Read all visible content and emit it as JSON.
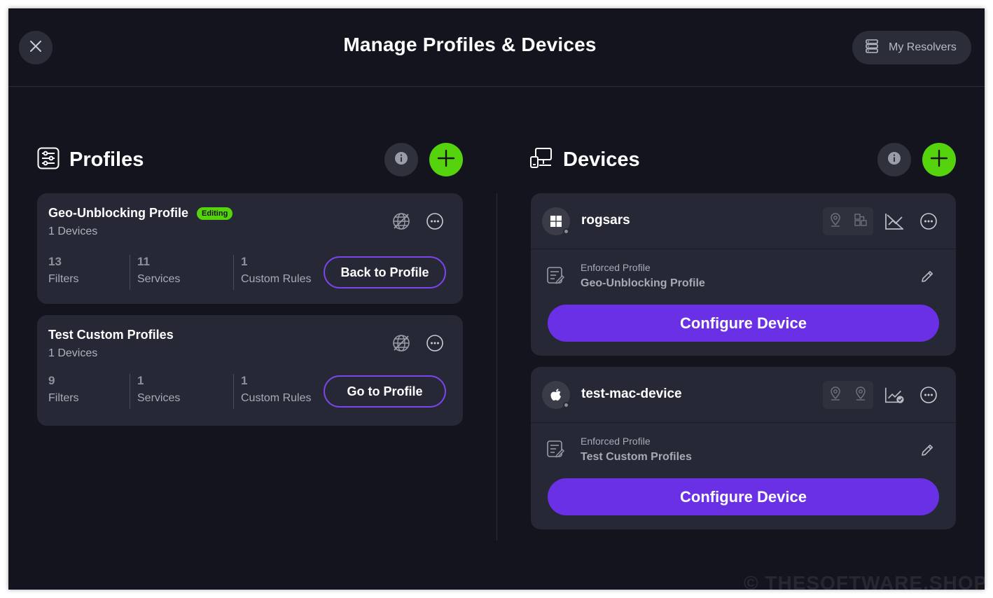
{
  "header": {
    "title": "Manage Profiles & Devices",
    "resolvers_label": "My Resolvers"
  },
  "colors": {
    "background": "#13141e",
    "card": "#262835",
    "accent_green": "#55d40d",
    "accent_purple": "#6a30e6"
  },
  "profiles": {
    "title": "Profiles",
    "items": [
      {
        "name": "Geo-Unblocking Profile",
        "badge": "Editing",
        "devices": "1 Devices",
        "filters_count": "13",
        "filters_label": "Filters",
        "services_count": "11",
        "services_label": "Services",
        "rules_count": "1",
        "rules_label": "Custom Rules",
        "action": "Back to Profile"
      },
      {
        "name": "Test Custom Profiles",
        "devices": "1 Devices",
        "filters_count": "9",
        "filters_label": "Filters",
        "services_count": "1",
        "services_label": "Services",
        "rules_count": "1",
        "rules_label": "Custom Rules",
        "action": "Go to Profile"
      }
    ]
  },
  "devices": {
    "title": "Devices",
    "items": [
      {
        "name": "rogsars",
        "os_icon": "windows-icon",
        "enforced_label": "Enforced Profile",
        "enforced_profile": "Geo-Unblocking Profile",
        "action": "Configure Device"
      },
      {
        "name": "test-mac-device",
        "os_icon": "apple-icon",
        "enforced_label": "Enforced Profile",
        "enforced_profile": "Test Custom Profiles",
        "action": "Configure Device"
      }
    ]
  },
  "watermark": "© THESOFTWARE.SHOP"
}
